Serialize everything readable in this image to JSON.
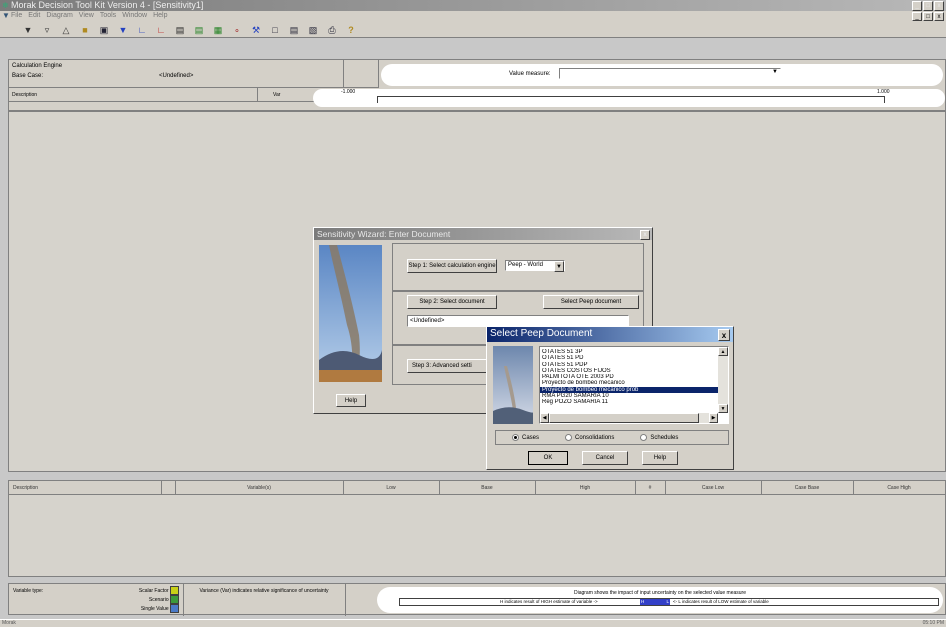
{
  "app": {
    "title": "Morak Decision Tool Kit Version 4 - [Sensitivity1]",
    "menu": [
      "File",
      "Edit",
      "Diagram",
      "View",
      "Tools",
      "Window",
      "Help"
    ],
    "window_controls": [
      "_",
      "□",
      "x"
    ],
    "status_left": "Morak",
    "status_right": "05:10 PM"
  },
  "toolbar": {
    "icons": [
      "funnel-icon",
      "filter-icon",
      "triangle-icon",
      "open-folder-icon",
      "save-icon",
      "sensitivity-filter-icon",
      "line-chart-icon",
      "curve-chart-icon",
      "table-icon",
      "tornado-icon",
      "spreadsheet-icon",
      "scatter-icon",
      "tools-icon",
      "window-icon",
      "panel-icon",
      "list-icon",
      "print-icon",
      "help-icon"
    ]
  },
  "top_panel": {
    "calc_engine_label": "Calculation Engine",
    "base_case_label": "Base Case:",
    "base_case_value": "<Undefined>",
    "value_measure_label": "Value measure:",
    "description_header": "Description",
    "var_header": "Var",
    "scale_min": "-1.000",
    "scale_max": "1.000"
  },
  "table": {
    "headers": [
      "Description",
      "",
      "Variable(s)",
      "Low",
      "Base",
      "High",
      "#",
      "Case Low",
      "Case Base",
      "Case High"
    ]
  },
  "legend": {
    "variable_type_label": "Variable type:",
    "types": [
      {
        "label": "Scalar Factor",
        "color": "#c8d018"
      },
      {
        "label": "Scenario",
        "color": "#3c9a3c"
      },
      {
        "label": "Single Value",
        "color": "#4a7ac8"
      }
    ],
    "variance_note": "Variance (Var) indicates relative significance of uncertainty",
    "diagram_note": "Diagram shows the impact of input uncertainty on the selected value measure",
    "high_low_note_left": "H indicates result of HIGH estimate of variable ->",
    "high_marker": "H",
    "low_marker": "L",
    "high_low_note_right": "<- L indicates result of LOW estimate of variable",
    "bar_color": "#3340c8"
  },
  "wizard": {
    "title": "Sensitivity Wizard: Enter Document",
    "close": "x",
    "step1_label": "Step 1: Select calculation engine",
    "engine_value": "Peep - World",
    "step2_label": "Step 2: Select document",
    "select_doc_button": "Select Peep document",
    "document_value": "<Undefined>",
    "step3_label": "Step 3: Advanced setti",
    "help_button": "Help"
  },
  "peep_dialog": {
    "title": "Select Peep Document",
    "close": "x",
    "items": [
      "OTATES 51 3P",
      "OTATES 51 PD",
      "OTATES 51 PDP",
      "OTATES COSTOS FIJOS",
      "PALMITOTA OTE 2003 PD",
      "Proyecto de bombeo mecanico",
      "Proyecto de bombeo mecanico prob",
      "RMA PG20 SAMARIA 10",
      "Reg POZO SAMARIA 11"
    ],
    "selected_index": 6,
    "radios": [
      {
        "label": "Cases",
        "checked": true
      },
      {
        "label": "Consolidations",
        "checked": false
      },
      {
        "label": "Schedules",
        "checked": false
      }
    ],
    "ok": "OK",
    "cancel": "Cancel",
    "help": "Help"
  }
}
